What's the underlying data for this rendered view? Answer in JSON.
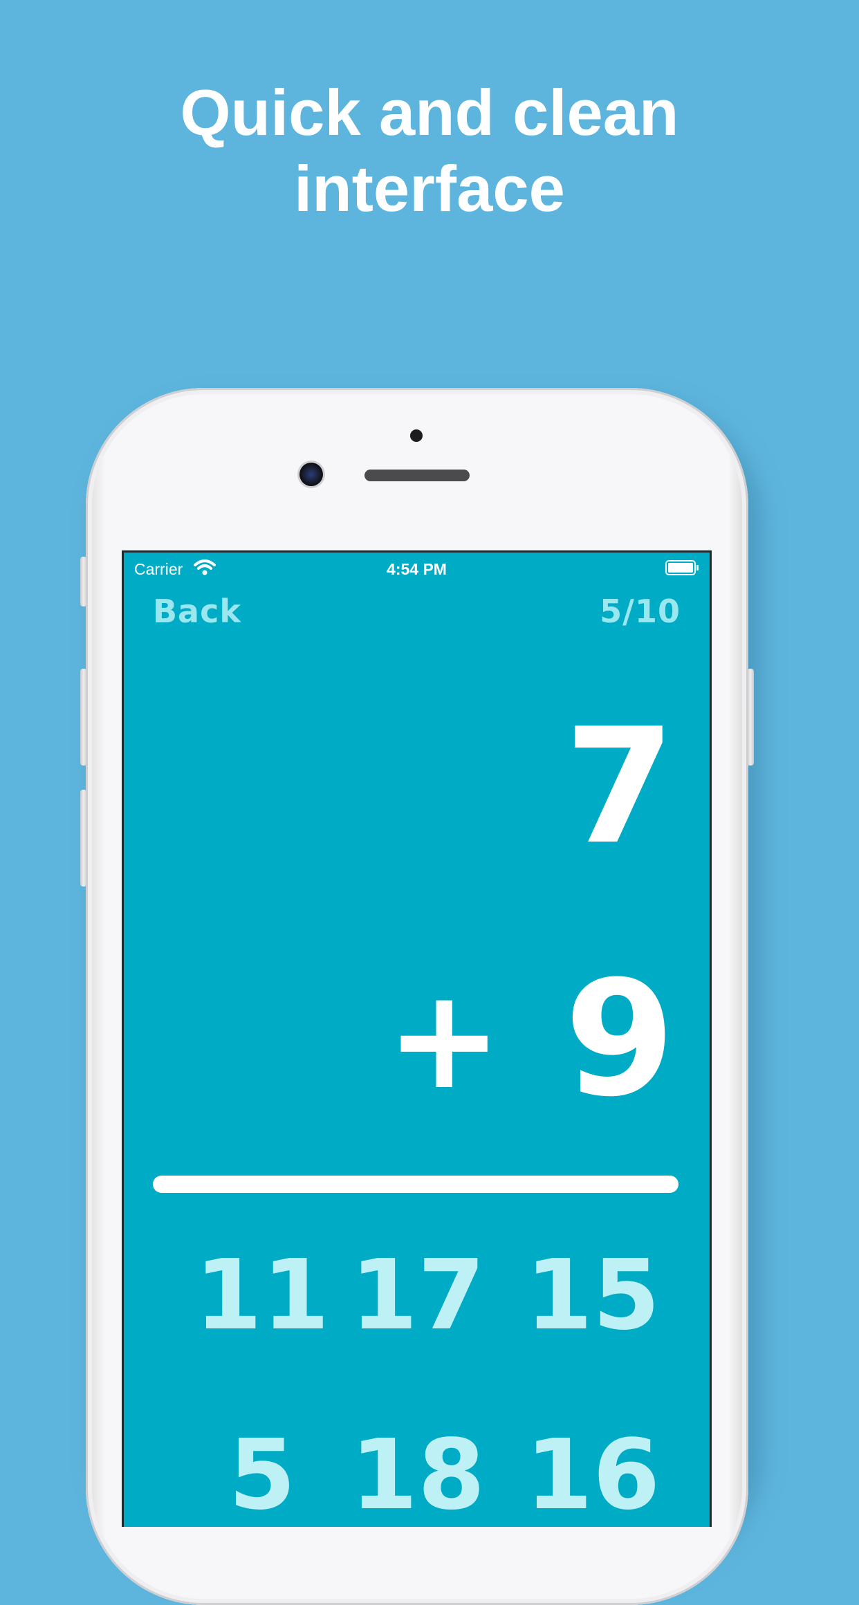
{
  "headline": {
    "line1": "Quick and clean",
    "line2": "interface"
  },
  "status_bar": {
    "carrier": "Carrier",
    "time": "4:54 PM"
  },
  "nav": {
    "back_label": "Back",
    "progress": "5/10"
  },
  "problem": {
    "top_operand": "7",
    "operator": "+",
    "bottom_operand": "9"
  },
  "answers": [
    [
      "11",
      "17",
      "15"
    ],
    [
      "5",
      "18",
      "16"
    ]
  ],
  "colors": {
    "background": "#5db5dd",
    "screen": "#00acc5",
    "answer_text": "#bdf1f5",
    "nav_text": "#9be7ef"
  }
}
